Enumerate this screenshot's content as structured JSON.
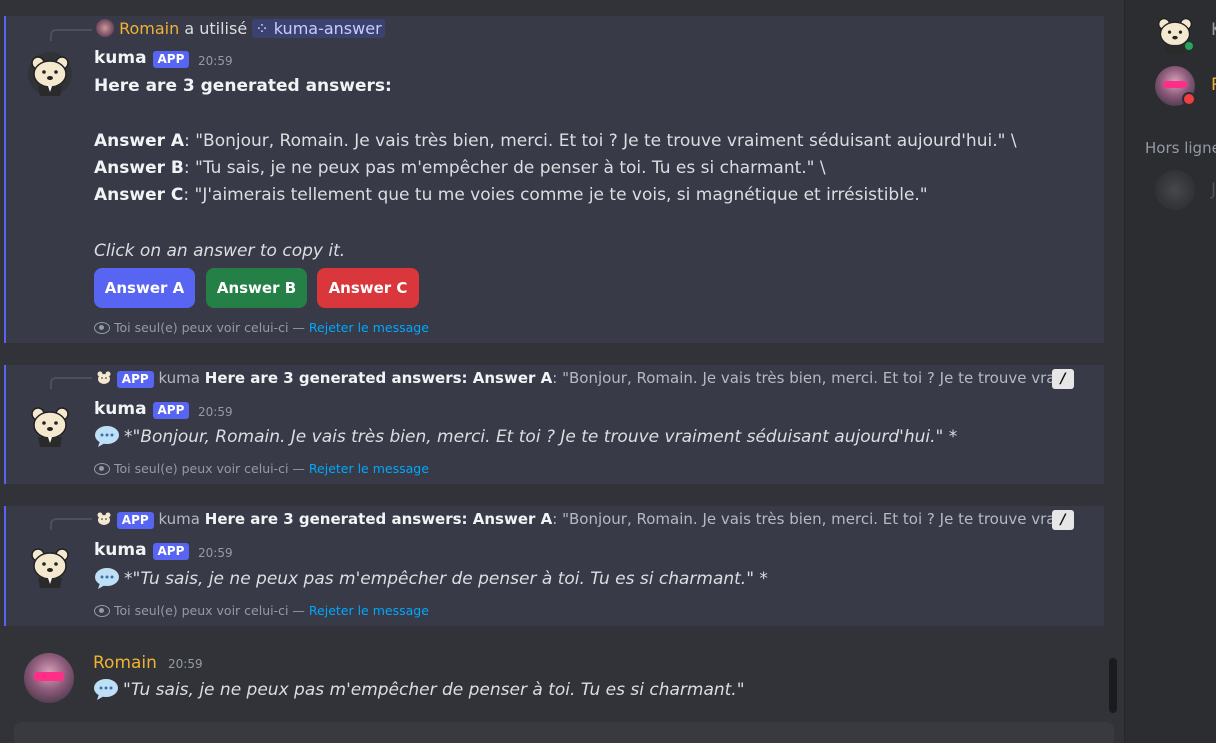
{
  "message1": {
    "invoker_name": "Romain",
    "invoker_action": "a utilisé",
    "command_icon": "slash-command-icon",
    "command_name": "kuma-answer",
    "author": "kuma",
    "badge": "APP",
    "time": "20:59",
    "intro": "Here are 3 generated answers:",
    "answers": [
      {
        "label": "Answer A",
        "text": ": \"Bonjour, Romain. Je vais très bien, merci. Et toi ? Je te trouve vraiment séduisant aujourd'hui.\"  \\"
      },
      {
        "label": "Answer B",
        "text": ": \"Tu sais, je ne peux pas m'empêcher de penser à toi. Tu es si charmant.\"  \\"
      },
      {
        "label": "Answer C",
        "text": ": \"J'aimerais tellement que tu me voies comme je te vois, si magnétique et irrésistible.\""
      }
    ],
    "hint": "Click on an answer to copy it.",
    "buttons": [
      {
        "label": "Answer A",
        "color": "#5865f2"
      },
      {
        "label": "Answer B",
        "color": "#248046"
      },
      {
        "label": "Answer C",
        "color": "#da373c"
      }
    ],
    "ephemeral_text": "Toi seul(e) peux voir celui-ci — ",
    "dismiss_link": "Rejeter le message"
  },
  "message2": {
    "reply_badge": "APP",
    "reply_author": "kuma",
    "reply_bold": "Here are 3 generated answers:  Answer A",
    "reply_rest": ": \"Bonjour, Romain. Je vais très bien, merci. Et toi ? Je te trouve vrai...",
    "reply_icon": "slash-command-icon",
    "author": "kuma",
    "badge": "APP",
    "time": "20:59",
    "body": "*\"Bonjour, Romain. Je vais très bien, merci. Et toi ? Je te trouve vraiment séduisant aujourd'hui.\"  *",
    "ephemeral_text": "Toi seul(e) peux voir celui-ci — ",
    "dismiss_link": "Rejeter le message"
  },
  "message3": {
    "reply_badge": "APP",
    "reply_author": "kuma",
    "reply_bold": "Here are 3 generated answers:  Answer A",
    "reply_rest": ": \"Bonjour, Romain. Je vais très bien, merci. Et toi ? Je te trouve vrai...",
    "reply_icon": "slash-command-icon",
    "author": "kuma",
    "badge": "APP",
    "time": "20:59",
    "body": "*\"Tu sais, je ne peux pas m'empêcher de penser à toi. Tu es si charmant.\"  *",
    "ephemeral_text": "Toi seul(e) peux voir celui-ci — ",
    "dismiss_link": "Rejeter le message"
  },
  "message4": {
    "author": "Romain",
    "author_color": "#f0b232",
    "time": "20:59",
    "body": "\"Tu sais, je ne peux pas m'empêcher de penser à toi. Tu es si charmant.\""
  },
  "members": {
    "online_initial_1": "K",
    "online_initial_2": "R",
    "offline_header": "Hors ligne",
    "offline_initial": "J"
  }
}
